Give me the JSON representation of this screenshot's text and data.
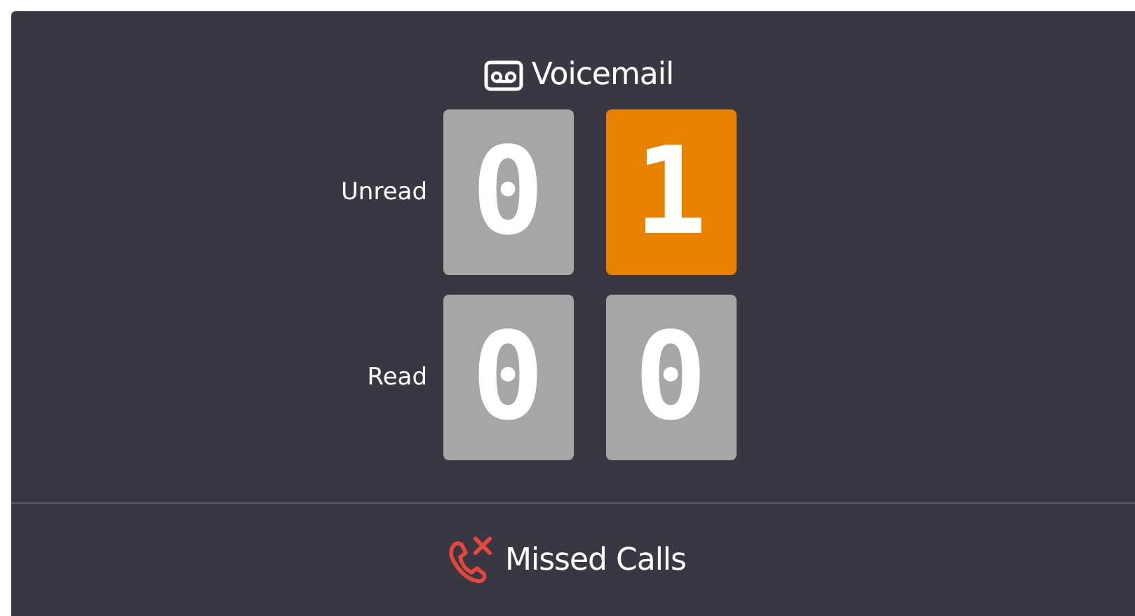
{
  "voicemail": {
    "title": "Voicemail",
    "counters": [
      {
        "label": "Unread",
        "digits": [
          {
            "value": "0",
            "highlighted": false
          },
          {
            "value": "1",
            "highlighted": true
          }
        ]
      },
      {
        "label": "Read",
        "digits": [
          {
            "value": "0",
            "highlighted": false
          },
          {
            "value": "0",
            "highlighted": false
          }
        ]
      }
    ]
  },
  "missed_calls": {
    "title": "Missed Calls"
  }
}
